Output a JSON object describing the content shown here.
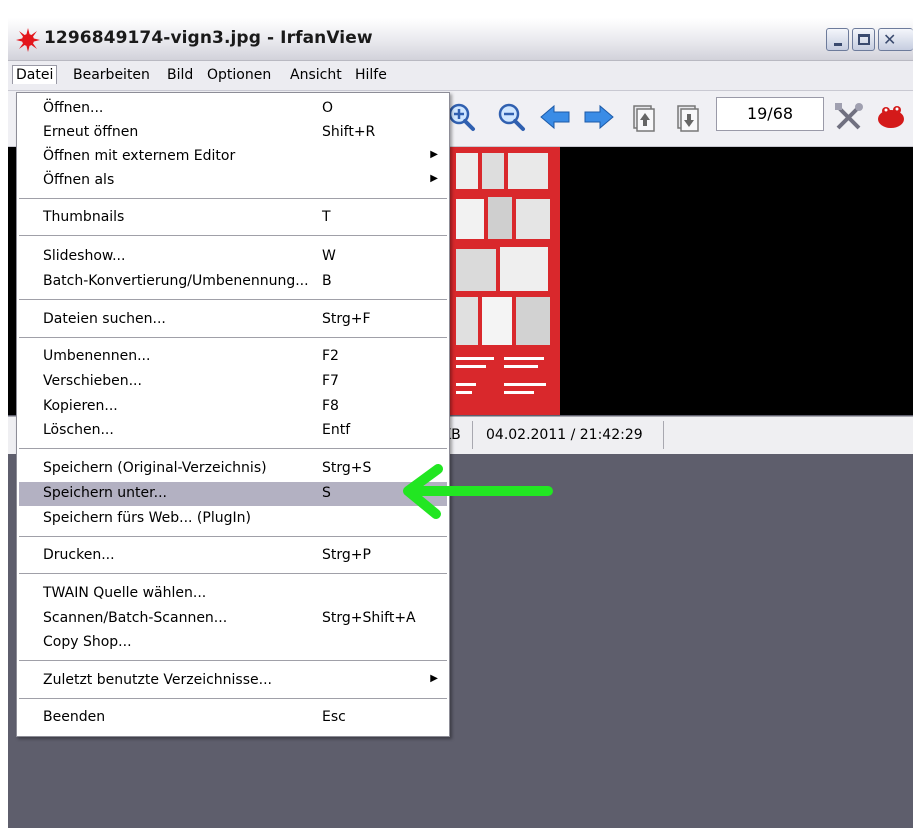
{
  "window": {
    "title": "1296849174-vign3.jpg - IrfanView"
  },
  "menubar": {
    "items": [
      {
        "label": "Datei",
        "active": true
      },
      {
        "label": "Bearbeiten"
      },
      {
        "label": "Bild"
      },
      {
        "label": "Optionen"
      },
      {
        "label": "Ansicht"
      },
      {
        "label": "Hilfe"
      }
    ]
  },
  "toolbar": {
    "icons": [
      "zoom-in-icon",
      "zoom-out-icon",
      "arrow-left-icon",
      "arrow-right-icon",
      "page-up-icon",
      "page-down-icon",
      "tools-icon",
      "irfanview-logo-icon"
    ],
    "page_counter": "19/68"
  },
  "statusbar": {
    "size_fragment": "KB",
    "datetime": "04.02.2011 / 21:42:29"
  },
  "file_menu": {
    "items": [
      {
        "label": "Öffnen...",
        "shortcut": "O"
      },
      {
        "label": "Erneut öffnen",
        "shortcut": "Shift+R"
      },
      {
        "label": "Öffnen mit externem Editor",
        "shortcut": "",
        "submenu": true
      },
      {
        "label": "Öffnen als",
        "shortcut": "",
        "submenu": true
      },
      {
        "label": "Thumbnails",
        "shortcut": "T"
      },
      {
        "label": "Slideshow...",
        "shortcut": "W"
      },
      {
        "label": "Batch-Konvertierung/Umbenennung...",
        "shortcut": "B"
      },
      {
        "label": "Dateien suchen...",
        "shortcut": "Strg+F"
      },
      {
        "label": "Umbenennen...",
        "shortcut": "F2"
      },
      {
        "label": "Verschieben...",
        "shortcut": "F7"
      },
      {
        "label": "Kopieren...",
        "shortcut": "F8"
      },
      {
        "label": "Löschen...",
        "shortcut": "Entf"
      },
      {
        "label": "Speichern (Original-Verzeichnis)",
        "shortcut": "Strg+S"
      },
      {
        "label": "Speichern unter...",
        "shortcut": "S",
        "highlighted": true
      },
      {
        "label": "Speichern fürs Web... (PlugIn)",
        "shortcut": ""
      },
      {
        "label": "Drucken...",
        "shortcut": "Strg+P"
      },
      {
        "label": "TWAIN Quelle wählen...",
        "shortcut": ""
      },
      {
        "label": "Scannen/Batch-Scannen...",
        "shortcut": "Strg+Shift+A"
      },
      {
        "label": "Copy Shop...",
        "shortcut": ""
      },
      {
        "label": "Zuletzt benutzte Verzeichnisse...",
        "shortcut": "",
        "submenu": true
      },
      {
        "label": "Beenden",
        "shortcut": "Esc"
      }
    ]
  },
  "annotation": {
    "arrow_color": "#22e622"
  },
  "colors": {
    "window_bg": "#5e5e6c",
    "menu_highlight": "#b3b1c2",
    "poster_red": "#d9282c"
  }
}
